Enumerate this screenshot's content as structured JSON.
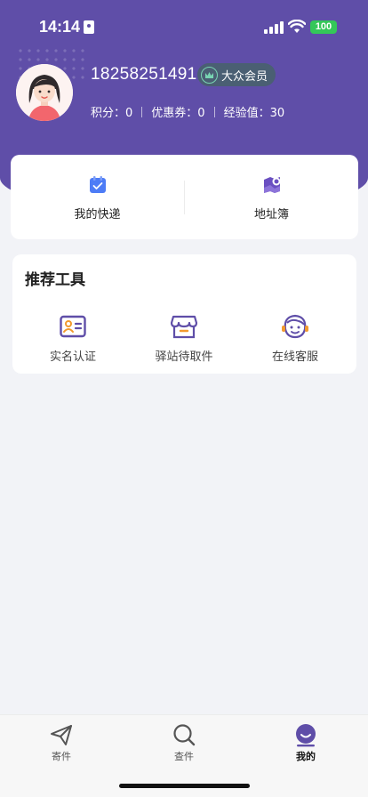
{
  "status_bar": {
    "time": "14:14",
    "battery": "100"
  },
  "profile": {
    "phone": "18258251491",
    "member_label": "大众会员",
    "points_label": "积分：0",
    "coupons_label": "优惠券：0",
    "exp_label": "经验值：30"
  },
  "main_card": {
    "items": [
      {
        "label": "我的快递",
        "icon": "package-list-icon"
      },
      {
        "label": "地址簿",
        "icon": "map-location-icon"
      }
    ]
  },
  "tools": {
    "title": "推荐工具",
    "items": [
      {
        "label": "实名认证",
        "icon": "id-card-icon"
      },
      {
        "label": "驿站待取件",
        "icon": "storefront-icon"
      },
      {
        "label": "在线客服",
        "icon": "customer-service-icon"
      }
    ]
  },
  "tabbar": {
    "items": [
      {
        "label": "寄件",
        "icon": "paper-plane-icon"
      },
      {
        "label": "查件",
        "icon": "search-icon"
      },
      {
        "label": "我的",
        "icon": "profile-icon"
      }
    ]
  },
  "colors": {
    "brand": "#5f4ea8",
    "accent_blue": "#4d7cf6",
    "accent_purple": "#6a4fc1",
    "accent_orange": "#f29a2e",
    "battery": "#34c759"
  }
}
